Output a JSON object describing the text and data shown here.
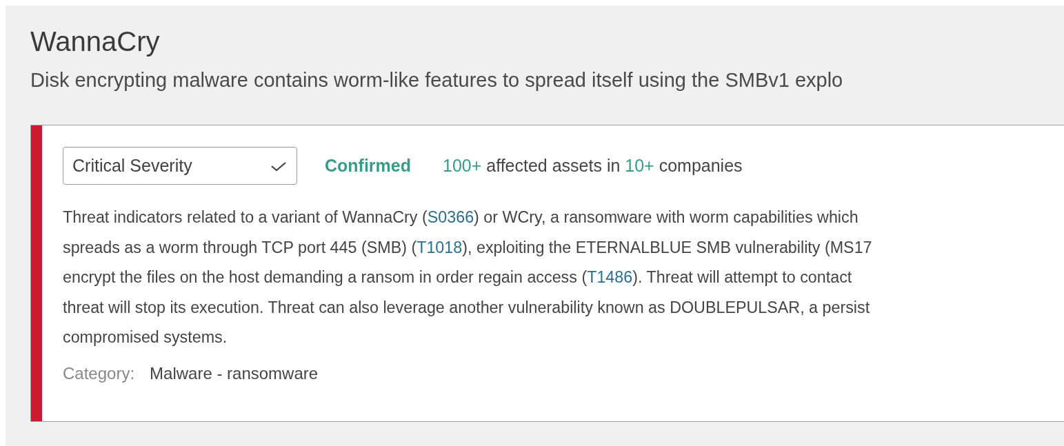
{
  "threat": {
    "title": "WannaCry",
    "summary": "Disk encrypting malware contains worm-like features to spread itself using the SMBv1 explo"
  },
  "card": {
    "severity_select": {
      "value": "Critical Severity"
    },
    "status": "Confirmed",
    "stats": [
      {
        "kind": "count",
        "text": "100+"
      },
      {
        "kind": "text",
        "text": " affected assets in "
      },
      {
        "kind": "count",
        "text": "10+"
      },
      {
        "kind": "text",
        "text": " companies"
      }
    ],
    "description_lines": [
      [
        {
          "kind": "text",
          "text": "Threat indicators related to a variant of WannaCry ("
        },
        {
          "kind": "link",
          "text": "S0366"
        },
        {
          "kind": "text",
          "text": ") or WCry, a ransomware with worm capabilities which"
        }
      ],
      [
        {
          "kind": "text",
          "text": "spreads as a worm through TCP port 445 (SMB) ("
        },
        {
          "kind": "link",
          "text": "T1018"
        },
        {
          "kind": "text",
          "text": "), exploiting the ETERNALBLUE SMB vulnerability (MS17"
        }
      ],
      [
        {
          "kind": "text",
          "text": "encrypt the files on the host demanding a ransom in order regain access ("
        },
        {
          "kind": "link",
          "text": "T1486"
        },
        {
          "kind": "text",
          "text": "). Threat will attempt to contact"
        }
      ],
      [
        {
          "kind": "text",
          "text": "threat will stop its execution. Threat can also leverage another vulnerability known as DOUBLEPULSAR, a persist"
        }
      ],
      [
        {
          "kind": "text",
          "text": "compromised systems."
        }
      ]
    ],
    "category": {
      "label": "Category:",
      "value": "Malware - ransomware"
    }
  }
}
